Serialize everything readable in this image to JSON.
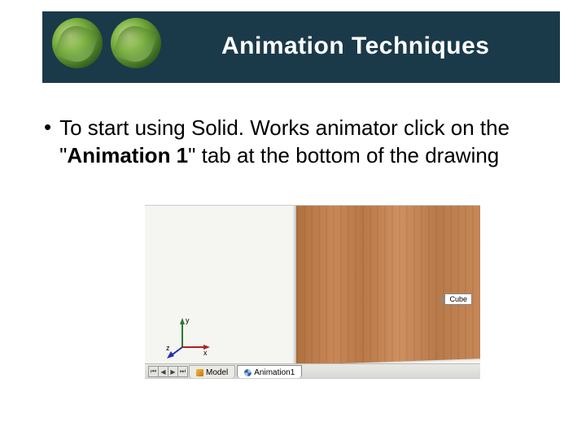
{
  "header": {
    "title": "Animation Techniques"
  },
  "bullet": {
    "marker": "•",
    "text_before": "To start using Solid. Works animator click on the \"",
    "text_bold": "Animation 1",
    "text_after": "\" tab at the bottom of the drawing"
  },
  "screenshot": {
    "cube_label": "Cube",
    "axes": {
      "x": "x",
      "y": "y",
      "z": "z"
    },
    "tab_scroll": {
      "first": "⏮",
      "prev": "◀",
      "next": "▶",
      "last": "⏭"
    },
    "tabs": {
      "model": "Model",
      "animation": "Animation1"
    }
  }
}
